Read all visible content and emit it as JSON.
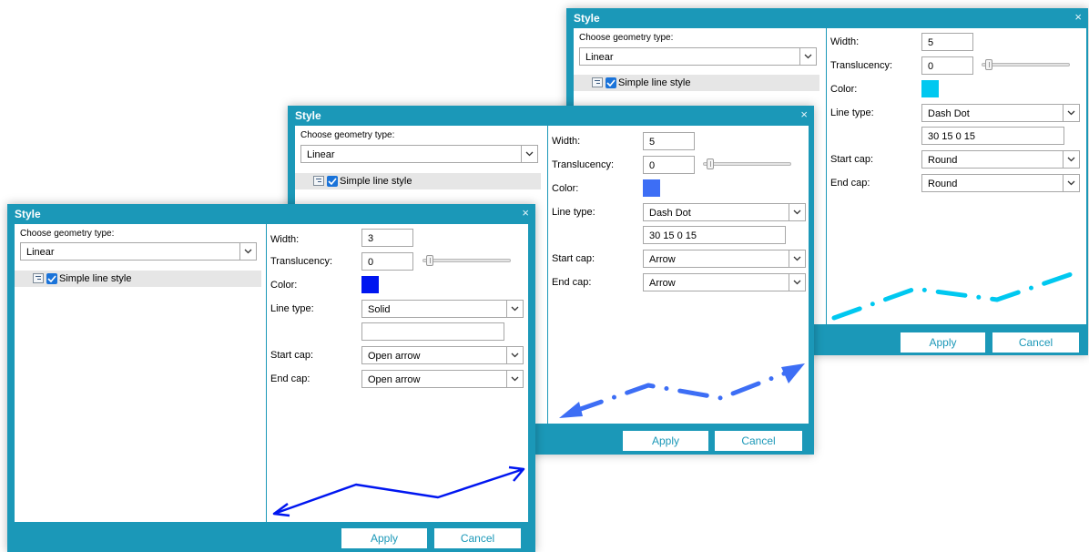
{
  "dialogs": [
    {
      "title": "Style",
      "close": "×",
      "geometry_label": "Choose geometry type:",
      "geometry_value": "Linear",
      "tree_item": "Simple line style",
      "labels": {
        "width": "Width:",
        "translucency": "Translucency:",
        "color": "Color:",
        "line_type": "Line type:",
        "start_cap": "Start cap:",
        "end_cap": "End cap:"
      },
      "width_value": "5",
      "translucency_value": "0",
      "translucency_level": 0,
      "color": "#00c8f0",
      "line_type_value": "Dash Dot",
      "dash_pattern": "30 15 0 15",
      "start_cap_value": "Round",
      "end_cap_value": "Round",
      "apply": "Apply",
      "cancel": "Cancel"
    },
    {
      "title": "Style",
      "close": "×",
      "geometry_label": "Choose geometry type:",
      "geometry_value": "Linear",
      "tree_item": "Simple line style",
      "labels": {
        "width": "Width:",
        "translucency": "Translucency:",
        "color": "Color:",
        "line_type": "Line type:",
        "start_cap": "Start cap:",
        "end_cap": "End cap:"
      },
      "width_value": "5",
      "translucency_value": "0",
      "translucency_level": 0,
      "color": "#3d6ef5",
      "line_type_value": "Dash Dot",
      "dash_pattern": "30 15 0 15",
      "start_cap_value": "Arrow",
      "end_cap_value": "Arrow",
      "apply": "Apply",
      "cancel": "Cancel"
    },
    {
      "title": "Style",
      "close": "×",
      "geometry_label": "Choose geometry type:",
      "geometry_value": "Linear",
      "tree_item": "Simple line style",
      "labels": {
        "width": "Width:",
        "translucency": "Translucency:",
        "color": "Color:",
        "line_type": "Line type:",
        "start_cap": "Start cap:",
        "end_cap": "End cap:"
      },
      "width_value": "3",
      "translucency_value": "0",
      "translucency_level": 0,
      "color": "#0016f0",
      "line_type_value": "Solid",
      "dash_pattern": "",
      "start_cap_value": "Open arrow",
      "end_cap_value": "Open arrow",
      "apply": "Apply",
      "cancel": "Cancel"
    }
  ]
}
